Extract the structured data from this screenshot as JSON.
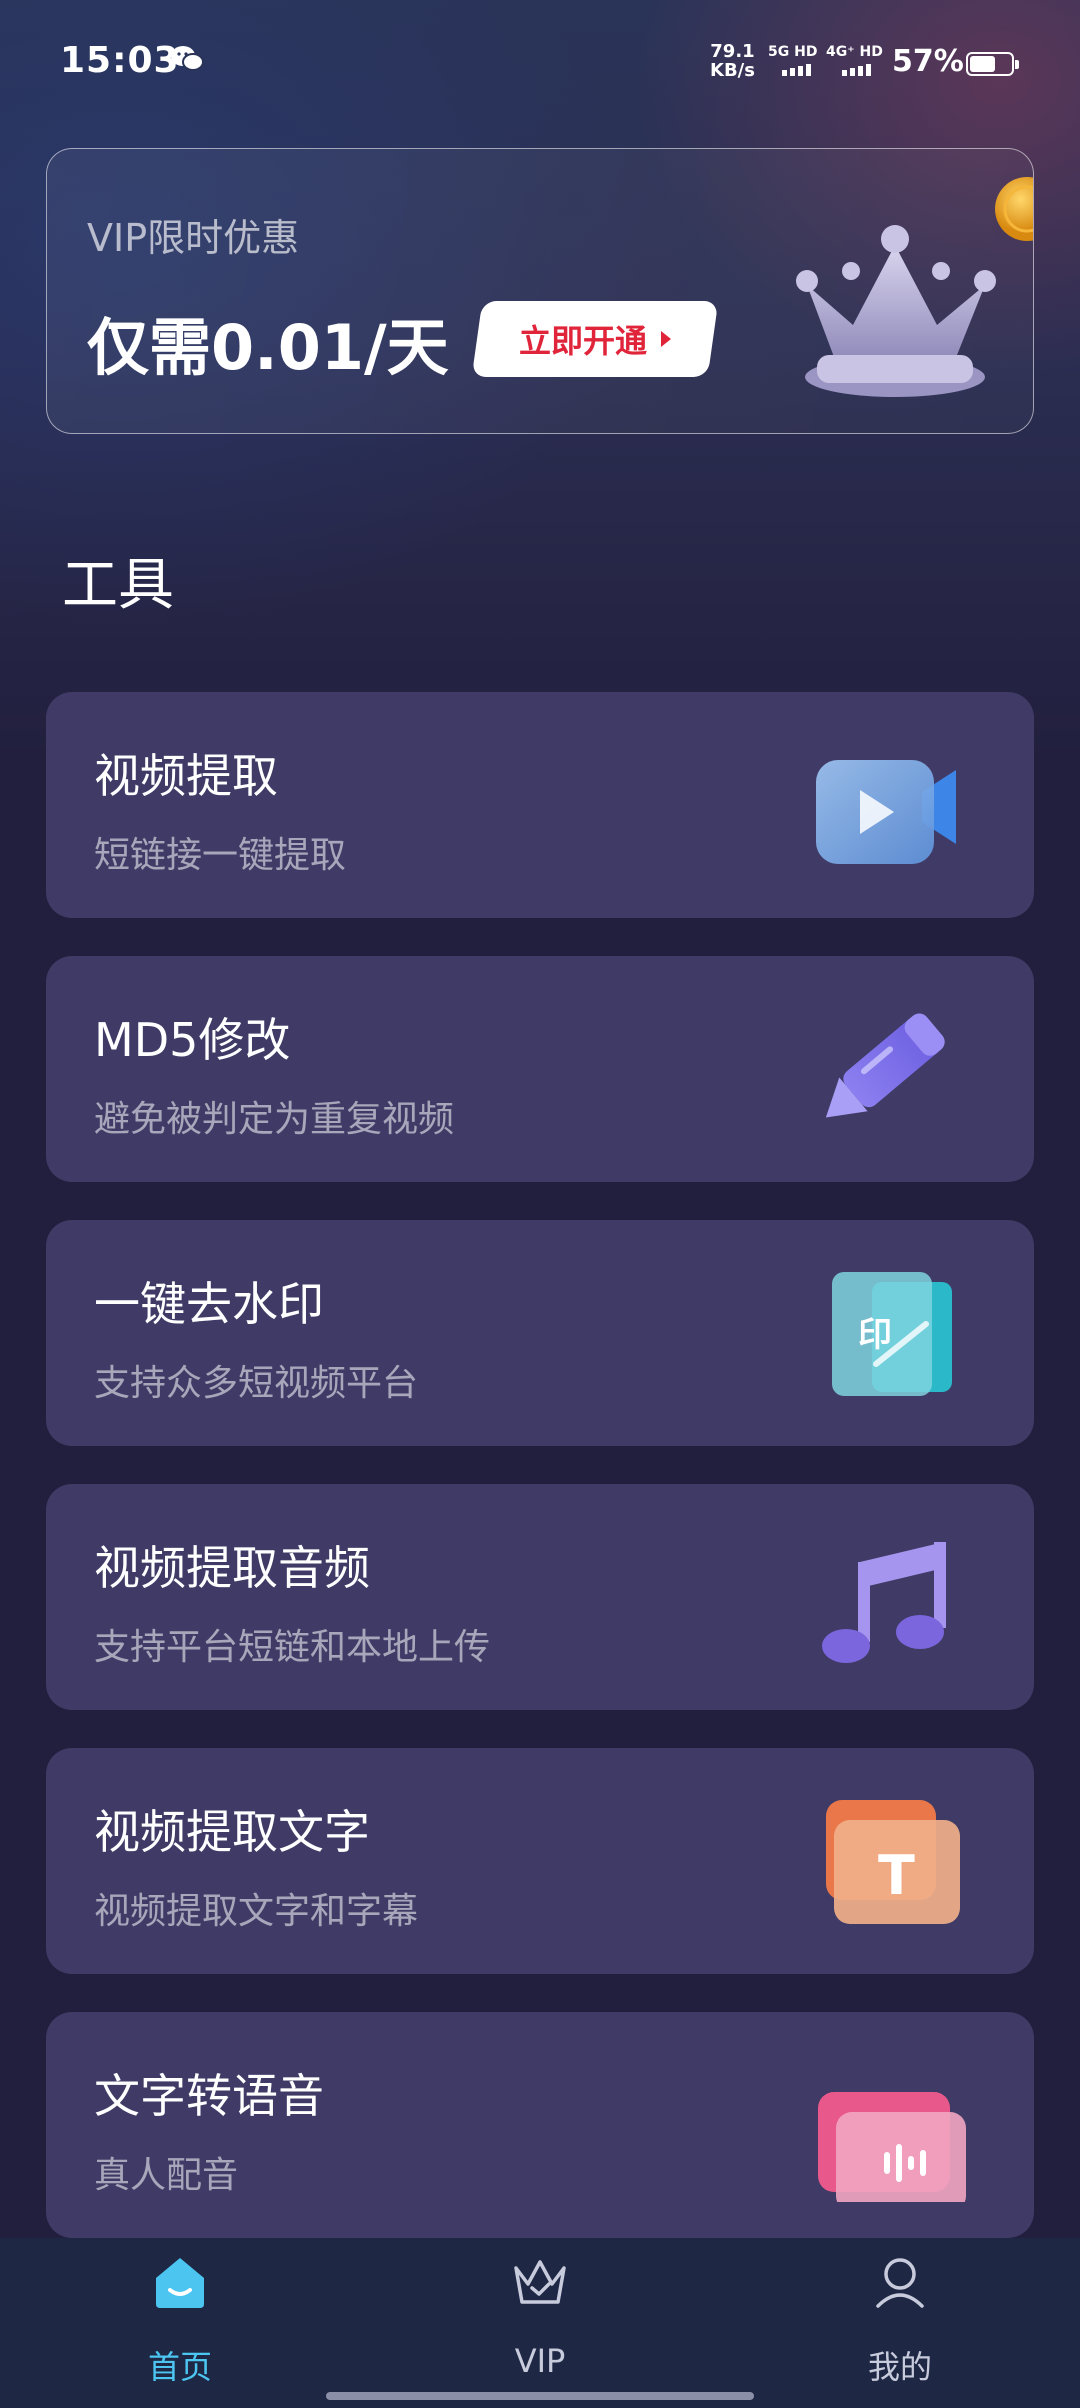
{
  "status_bar": {
    "time": "15:03",
    "net_speed_value": "79.1",
    "net_speed_unit": "KB/s",
    "sim1": "5G HD",
    "sim2": "4G⁺ HD",
    "battery": "57%"
  },
  "vip_banner": {
    "subtitle": "VIP限时优惠",
    "price": "仅需0.01/天",
    "button": "立即开通"
  },
  "section_title": "工具",
  "tools": [
    {
      "title": "视频提取",
      "desc": "短链接一键提取",
      "icon": "video-camera-icon"
    },
    {
      "title": "MD5修改",
      "desc": "避免被判定为重复视频",
      "icon": "pen-icon"
    },
    {
      "title": "一键去水印",
      "desc": "支持众多短视频平台",
      "icon": "stamp-icon"
    },
    {
      "title": "视频提取音频",
      "desc": "支持平台短链和本地上传",
      "icon": "music-note-icon"
    },
    {
      "title": "视频提取文字",
      "desc": "视频提取文字和字幕",
      "icon": "text-t-icon"
    },
    {
      "title": "文字转语音",
      "desc": "真人配音",
      "icon": "voice-wave-icon"
    }
  ],
  "tabbar": {
    "items": [
      {
        "label": "首页",
        "icon": "home-icon",
        "active": true
      },
      {
        "label": "VIP",
        "icon": "crown-icon",
        "active": false
      },
      {
        "label": "我的",
        "icon": "user-icon",
        "active": false
      }
    ]
  },
  "colors": {
    "background": "#221f3e",
    "card": "#3f3b66",
    "accent_active": "#4cc6f0",
    "vip_button_text": "#e0243a",
    "tabbar": "#1e2845"
  }
}
